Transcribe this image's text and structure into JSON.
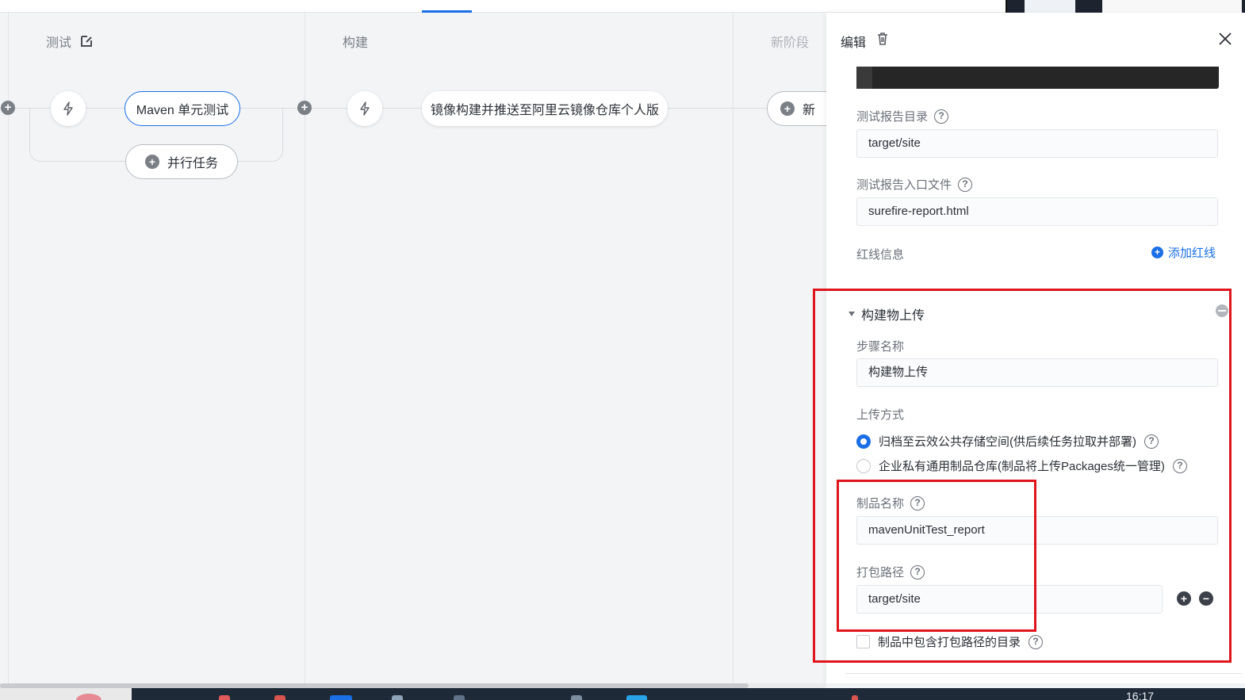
{
  "pipeline": {
    "stages": [
      {
        "title": "测试"
      },
      {
        "title": "构建"
      },
      {
        "title": "新阶段"
      }
    ],
    "tasks": {
      "maven_unit_test": "Maven 单元测试",
      "parallel_task": "并行任务",
      "image_build_push": "镜像构建并推送至阿里云镜像仓库个人版",
      "new_task_partial": "新"
    }
  },
  "panel": {
    "title": "编辑",
    "fields": {
      "report_dir_label": "测试报告目录",
      "report_dir_value": "target/site",
      "report_entry_label": "测试报告入口文件",
      "report_entry_value": "surefire-report.html",
      "redline_label": "红线信息",
      "add_redline": "添加红线"
    },
    "upload_section": {
      "title": "构建物上传",
      "step_name_label": "步骤名称",
      "step_name_value": "构建物上传",
      "upload_method_label": "上传方式",
      "options": [
        {
          "label": "归档至云效公共存储空间(供后续任务拉取并部署)",
          "checked": true
        },
        {
          "label": "企业私有通用制品仓库(制品将上传Packages统一管理)",
          "checked": false
        }
      ],
      "artifact_name_label": "制品名称",
      "artifact_name_value": "mavenUnitTest_report",
      "package_path_label": "打包路径",
      "package_path_value": "target/site",
      "include_dir_label": "制品中包含打包路径的目录",
      "include_dir_checked": false
    }
  },
  "taskbar": {
    "clock": "16:17"
  },
  "colors": {
    "accent": "#1b6fe6",
    "highlight": "#e0141c"
  }
}
